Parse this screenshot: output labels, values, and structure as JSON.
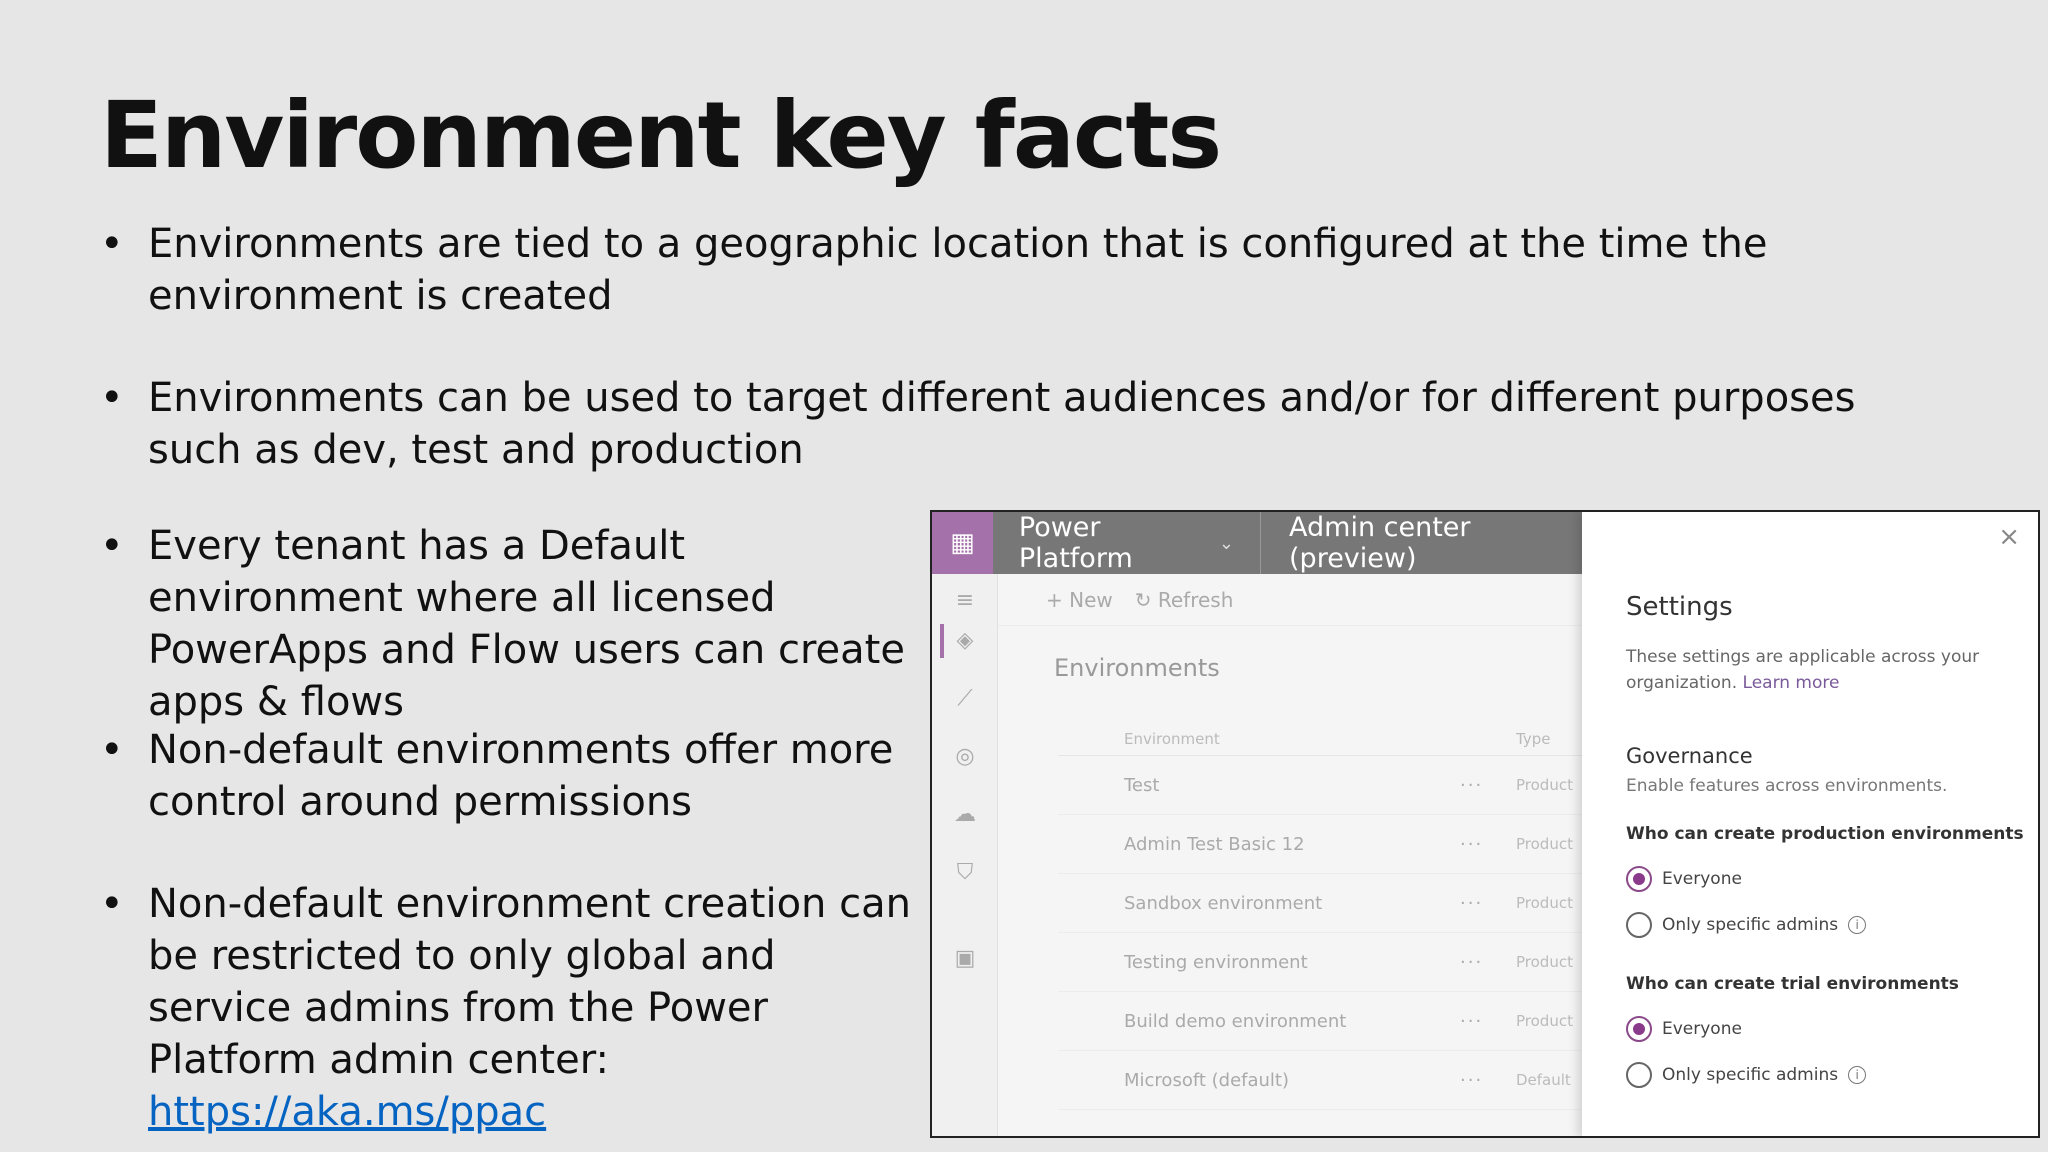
{
  "slide": {
    "title": "Environment key facts",
    "bullets": [
      "Environments are tied to a geographic location that is configured at the time the environment is created",
      "Environments can be used to target different audiences and/or for different purposes such as dev, test and production",
      "Every tenant has a Default environment where all licensed PowerApps and Flow users can create apps & flows",
      "Non-default environments offer more control around permissions",
      "Non-default environment creation can be restricted to only global and service admins from the Power Platform admin center: "
    ],
    "link_text": "https://aka.ms/ppac",
    "bullet_char": "•"
  },
  "shot": {
    "waffle": "▦",
    "brand": "Power Platform",
    "brand_chevron": "⌄",
    "admin_title": "Admin center (preview)",
    "cmd": {
      "new_icon": "+",
      "new_label": "New",
      "refresh_icon": "↻",
      "refresh_label": "Refresh"
    },
    "main_title": "Environments",
    "columns": {
      "environment": "Environment",
      "type": "Type"
    },
    "rows": [
      {
        "name": "Test",
        "dots": "···",
        "type": "Product"
      },
      {
        "name": "Admin Test Basic 12",
        "dots": "···",
        "type": "Product"
      },
      {
        "name": "Sandbox environment",
        "dots": "···",
        "type": "Product"
      },
      {
        "name": "Testing environment",
        "dots": "···",
        "type": "Product"
      },
      {
        "name": "Build demo environment",
        "dots": "···",
        "type": "Product"
      },
      {
        "name": "Microsoft (default)",
        "dots": "···",
        "type": "Default"
      }
    ],
    "nav_icons": [
      "hamburger-icon",
      "layers-icon",
      "analytics-icon",
      "help-icon",
      "cloud-icon",
      "shield-icon",
      "apps-icon"
    ],
    "panel": {
      "close": "×",
      "title": "Settings",
      "desc": "These settings are applicable across your organization.",
      "learn_more": "Learn more",
      "governance": "Governance",
      "governance_sub": "Enable features across environments.",
      "q1": "Who can create production environments",
      "q2": "Who can create trial environments",
      "opt_everyone": "Everyone",
      "opt_admins": "Only specific admins",
      "info": "i"
    }
  }
}
